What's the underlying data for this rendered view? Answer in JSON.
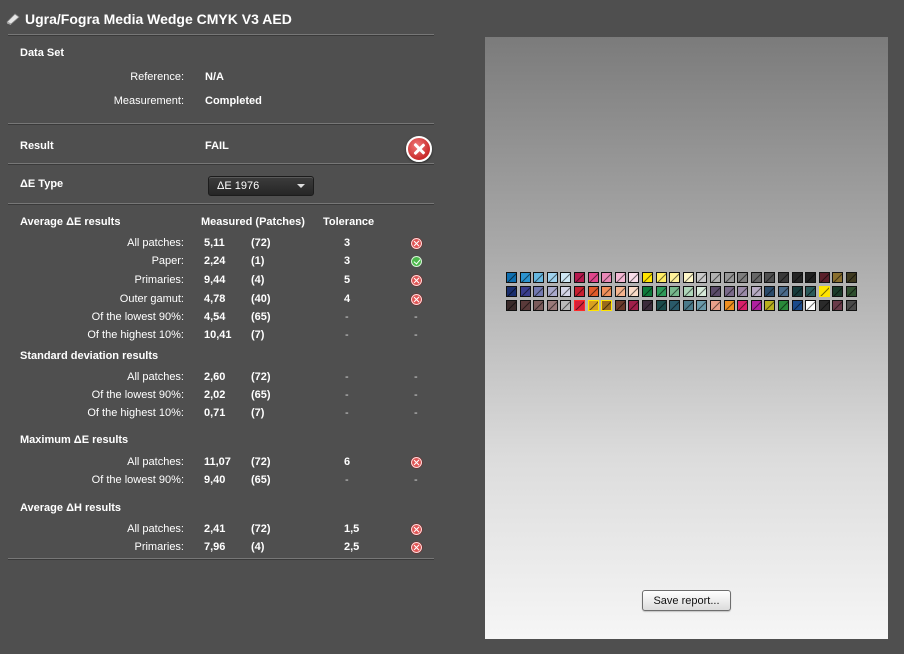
{
  "window": {
    "title": "Ugra/Fogra Media Wedge CMYK V3 AED"
  },
  "dataset": {
    "heading": "Data Set",
    "reference_label": "Reference:",
    "reference_value": "N/A",
    "measurement_label": "Measurement:",
    "measurement_value": "Completed"
  },
  "result": {
    "label": "Result",
    "value": "FAIL",
    "status": "fail"
  },
  "de_type": {
    "label": "ΔE Type",
    "selected": "ΔE 1976"
  },
  "avg_de": {
    "heading": "Average ΔE results",
    "col_measured": "Measured (Patches)",
    "col_tolerance": "Tolerance",
    "rows": [
      {
        "label": "All patches:",
        "measured": "5,11",
        "patches": "(72)",
        "tolerance": "3",
        "status": "fail"
      },
      {
        "label": "Paper:",
        "measured": "2,24",
        "patches": "(1)",
        "tolerance": "3",
        "status": "pass"
      },
      {
        "label": "Primaries:",
        "measured": "9,44",
        "patches": "(4)",
        "tolerance": "5",
        "status": "fail"
      },
      {
        "label": "Outer gamut:",
        "measured": "4,78",
        "patches": "(40)",
        "tolerance": "4",
        "status": "fail"
      },
      {
        "label": "Of the lowest 90%:",
        "measured": "4,54",
        "patches": "(65)",
        "tolerance": "-",
        "status": "-"
      },
      {
        "label": "Of the highest 10%:",
        "measured": "10,41",
        "patches": "(7)",
        "tolerance": "-",
        "status": "-"
      }
    ]
  },
  "std_dev": {
    "heading": "Standard deviation results",
    "rows": [
      {
        "label": "All patches:",
        "measured": "2,60",
        "patches": "(72)",
        "tolerance": "-",
        "status": "-"
      },
      {
        "label": "Of the lowest 90%:",
        "measured": "2,02",
        "patches": "(65)",
        "tolerance": "-",
        "status": "-"
      },
      {
        "label": "Of the highest 10%:",
        "measured": "0,71",
        "patches": "(7)",
        "tolerance": "-",
        "status": "-"
      }
    ]
  },
  "max_de": {
    "heading": "Maximum ΔE results",
    "rows": [
      {
        "label": "All patches:",
        "measured": "11,07",
        "patches": "(72)",
        "tolerance": "6",
        "status": "fail"
      },
      {
        "label": "Of the lowest 90%:",
        "measured": "9,40",
        "patches": "(65)",
        "tolerance": "-",
        "status": "-"
      }
    ]
  },
  "avg_dh": {
    "heading": "Average ΔH results",
    "rows": [
      {
        "label": "All patches:",
        "measured": "2,41",
        "patches": "(72)",
        "tolerance": "1,5",
        "status": "fail"
      },
      {
        "label": "Primaries:",
        "measured": "7,96",
        "patches": "(4)",
        "tolerance": "2,5",
        "status": "fail"
      }
    ]
  },
  "patches": {
    "rows": [
      [
        "#0f6fb0",
        "#2b93cf",
        "#66b7e0",
        "#9fd2ee",
        "#cfe8f6",
        "#b51a4e",
        "#e0468c",
        "#ea88b6",
        "#f2b7d2",
        "#f8dde9",
        "#ffe400",
        "#ffec63",
        "#fff29b",
        "#fff8c9",
        "#c9c9c9",
        "#b0b0b0",
        "#969696",
        "#7e7e7e",
        "#666666",
        "#4f4f4f",
        "#393939",
        "#242424",
        "#1f1f1f",
        "#5a1f2a",
        "#8a6f2f",
        "#3f3a20"
      ],
      [
        "#1a2f6e",
        "#3a3d8e",
        "#7379b0",
        "#a9aacc",
        "#d4d4e6",
        "#c81f2f",
        "#e15a2a",
        "#f08f5a",
        "#f5b58f",
        "#fadbc8",
        "#0f7a3a",
        "#2f9a5a",
        "#76b88c",
        "#aed5b8",
        "#d7ead9",
        "#5a4a6a",
        "#7a6a8a",
        "#9a8aa8",
        "#b6aac2",
        "#2a4a6a",
        "#4a6a8a",
        "#163a3a",
        "#2a5a5a",
        "#ffe400",
        "#1a3a2a",
        "#2f4f2f"
      ],
      [
        "#3a2a2a",
        "#5a3a3a",
        "#7a5a5a",
        "#9a7a7a",
        "#bababa",
        "#d81f3a",
        "#d8a020",
        "#9a6a1a",
        "#6a3a2a",
        "#a01f4a",
        "#3a2a3a",
        "#1a4a4a",
        "#2a5a6a",
        "#4a7a8a",
        "#6a9aaa",
        "#e8a08a",
        "#f09020",
        "#d81f6a",
        "#b01fa0",
        "#b8b020",
        "#2a8a3a",
        "#1a4a8a",
        "#ffffff",
        "#2a2a2a",
        "#6a3a4a",
        "#4a4a4a"
      ]
    ],
    "highlighted": [
      [
        1,
        23
      ],
      [
        2,
        5
      ],
      [
        2,
        6
      ],
      [
        2,
        7
      ]
    ]
  },
  "actions": {
    "save_report": "Save report..."
  }
}
